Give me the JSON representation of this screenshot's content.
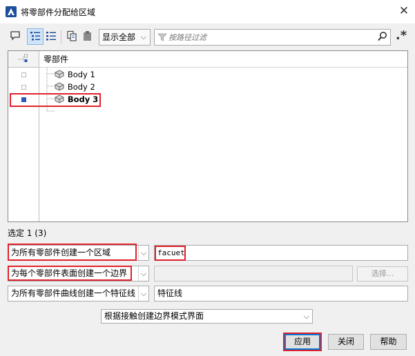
{
  "window": {
    "title": "将零部件分配给区域",
    "close_glyph": "✕"
  },
  "toolbar": {
    "buttons": [
      {
        "icon": "comment-icon"
      },
      {
        "icon": "tree-list-icon",
        "active": true
      },
      {
        "icon": "flat-list-icon"
      },
      {
        "icon": "copy-icon"
      },
      {
        "icon": "paste-icon"
      }
    ],
    "display_select": "显示全部",
    "filter_placeholder": "按路径过滤",
    "regex_glyph": ".*"
  },
  "tree": {
    "header": "零部件",
    "rows": [
      {
        "label": "Body 1",
        "checked": false,
        "bold": false
      },
      {
        "label": "Body 2",
        "checked": false,
        "bold": false
      },
      {
        "label": "Body 3",
        "checked": true,
        "bold": true
      }
    ]
  },
  "status": {
    "selection": "选定 1 (3)"
  },
  "form": {
    "region_mode": "为所有零部件创建一个区域",
    "region_name": "facuet",
    "boundary_mode": "为每个零部件表面创建一个边界",
    "boundary_field": "",
    "select_button": "选择...",
    "feature_mode": "为所有零部件曲线创建一个特征线",
    "feature_name": "特征线",
    "interface_mode": "根据接触创建边界模式界面"
  },
  "buttons": {
    "apply": "应用",
    "close": "关闭",
    "help": "帮助"
  },
  "colors": {
    "highlight_red": "#e0202a",
    "selected_check": "#2f57b8",
    "default_button_border": "#0078d7"
  }
}
